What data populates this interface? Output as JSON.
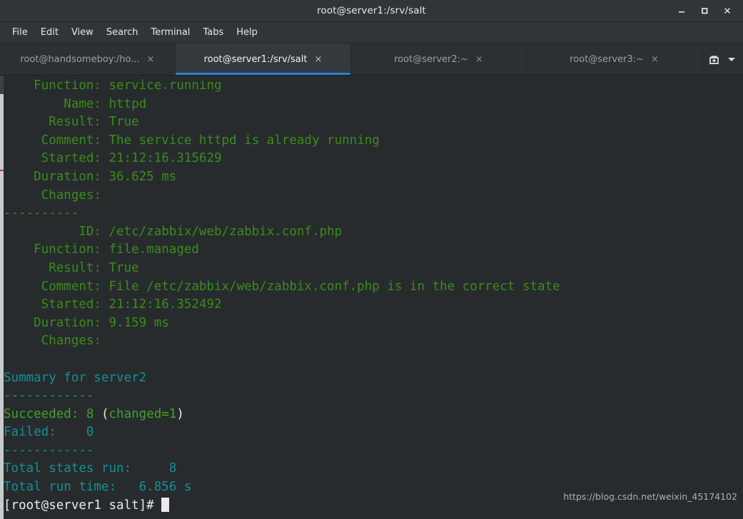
{
  "window": {
    "title": "root@server1:/srv/salt",
    "controls": [
      {
        "name": "minimize",
        "glyph": "minimize-icon"
      },
      {
        "name": "maximize",
        "glyph": "maximize-icon"
      },
      {
        "name": "close",
        "glyph": "close-icon"
      }
    ]
  },
  "menubar": {
    "items": [
      "File",
      "Edit",
      "View",
      "Search",
      "Terminal",
      "Tabs",
      "Help"
    ]
  },
  "tabbar": {
    "tabs": [
      {
        "label": "root@handsomeboy:/ho...",
        "active": false,
        "close": "×"
      },
      {
        "label": "root@server1:/srv/salt",
        "active": true,
        "close": "×"
      },
      {
        "label": "root@server2:~",
        "active": false,
        "close": "×"
      },
      {
        "label": "root@server3:~",
        "active": false,
        "close": "×"
      }
    ],
    "new_tab_icon": "new-tab-icon",
    "tab_menu_icon": "chevron-down-icon"
  },
  "terminal": {
    "colors": {
      "background": "#272b2d",
      "green": "#3a8c1c",
      "bright_green": "#3fa32a",
      "cyan": "#178f94",
      "white": "#e8eaeb"
    },
    "lines": [
      {
        "id": "l01",
        "segments": [
          {
            "t": "    Function: service.running",
            "c": "g"
          }
        ]
      },
      {
        "id": "l02",
        "segments": [
          {
            "t": "        Name: httpd",
            "c": "g"
          }
        ]
      },
      {
        "id": "l03",
        "segments": [
          {
            "t": "      Result: True",
            "c": "g"
          }
        ]
      },
      {
        "id": "l04",
        "segments": [
          {
            "t": "     Comment: The service httpd is already running",
            "c": "g"
          }
        ]
      },
      {
        "id": "l05",
        "segments": [
          {
            "t": "     Started: 21:12:16.315629",
            "c": "g"
          }
        ]
      },
      {
        "id": "l06",
        "segments": [
          {
            "t": "    Duration: 36.625 ms",
            "c": "g"
          }
        ]
      },
      {
        "id": "l07",
        "segments": [
          {
            "t": "     Changes:",
            "c": "g"
          }
        ]
      },
      {
        "id": "l08",
        "segments": [
          {
            "t": "----------",
            "c": "g"
          }
        ]
      },
      {
        "id": "l09",
        "segments": [
          {
            "t": "          ID: /etc/zabbix/web/zabbix.conf.php",
            "c": "g"
          }
        ]
      },
      {
        "id": "l10",
        "segments": [
          {
            "t": "    Function: file.managed",
            "c": "g"
          }
        ]
      },
      {
        "id": "l11",
        "segments": [
          {
            "t": "      Result: True",
            "c": "g"
          }
        ]
      },
      {
        "id": "l12",
        "segments": [
          {
            "t": "     Comment: File /etc/zabbix/web/zabbix.conf.php is in the correct state",
            "c": "g"
          }
        ]
      },
      {
        "id": "l13",
        "segments": [
          {
            "t": "     Started: 21:12:16.352492",
            "c": "g"
          }
        ]
      },
      {
        "id": "l14",
        "segments": [
          {
            "t": "    Duration: 9.159 ms",
            "c": "g"
          }
        ]
      },
      {
        "id": "l15",
        "segments": [
          {
            "t": "     Changes:",
            "c": "g"
          }
        ]
      },
      {
        "id": "l16",
        "segments": [
          {
            "t": "",
            "c": "g"
          }
        ]
      },
      {
        "id": "l17",
        "segments": [
          {
            "t": "Summary for server2",
            "c": "c"
          }
        ]
      },
      {
        "id": "l18",
        "segments": [
          {
            "t": "------------",
            "c": "c"
          }
        ]
      },
      {
        "id": "l19",
        "segments": [
          {
            "t": "Succeeded: 8 ",
            "c": "gb"
          },
          {
            "t": "(",
            "c": "w"
          },
          {
            "t": "changed=1",
            "c": "gb"
          },
          {
            "t": ")",
            "c": "w"
          }
        ]
      },
      {
        "id": "l20",
        "segments": [
          {
            "t": "Failed:    0",
            "c": "c"
          }
        ]
      },
      {
        "id": "l21",
        "segments": [
          {
            "t": "------------",
            "c": "c"
          }
        ]
      },
      {
        "id": "l22",
        "segments": [
          {
            "t": "Total states run:     8",
            "c": "c"
          }
        ]
      },
      {
        "id": "l23",
        "segments": [
          {
            "t": "Total run time:   6.856 s",
            "c": "c"
          }
        ]
      },
      {
        "id": "l24",
        "segments": [
          {
            "t": "[root@server1 salt]# ",
            "c": "w"
          }
        ],
        "cursor": true
      }
    ]
  },
  "watermark": {
    "text": "https://blog.csdn.net/weixin_45174102"
  }
}
